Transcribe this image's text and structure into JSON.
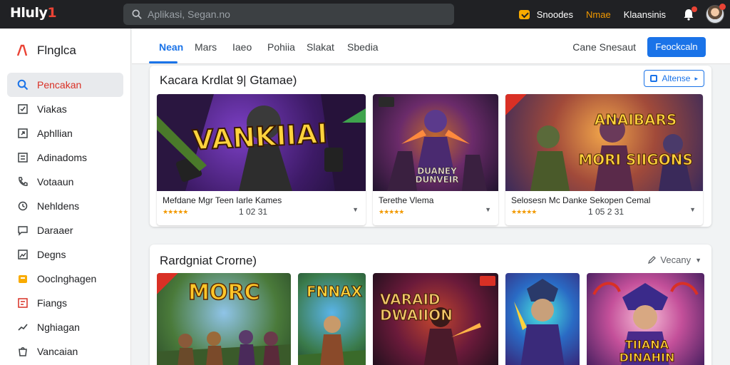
{
  "topbar": {
    "logo_main": "Hluly",
    "logo_accent": "1",
    "search_placeholder": "Aplikasi, Segan.no",
    "right_badge_label": "Snoodes",
    "link_orange": "Nmae",
    "link_white": "Klaansinis",
    "accent_color": "#ea4335"
  },
  "sidebar": {
    "brand": "Flnglca",
    "items": [
      {
        "label": "Pencakan",
        "icon": "search-icon",
        "active": true
      },
      {
        "label": "Viakas",
        "icon": "checkbox-icon"
      },
      {
        "label": "Aphllian",
        "icon": "expand-icon"
      },
      {
        "label": "Adinadoms",
        "icon": "grid-icon"
      },
      {
        "label": "Votaaun",
        "icon": "phone-icon"
      },
      {
        "label": "Nehldens",
        "icon": "history-icon"
      },
      {
        "label": "Daraaer",
        "icon": "chat-icon"
      },
      {
        "label": "Degns",
        "icon": "image-icon"
      },
      {
        "label": "Ooclnghagen",
        "icon": "box-icon"
      },
      {
        "label": "Fiangs",
        "icon": "tag-icon"
      },
      {
        "label": "Nghiagan",
        "icon": "trend-icon"
      },
      {
        "label": "Vancaian",
        "icon": "bag-icon"
      }
    ]
  },
  "main": {
    "tabs": [
      {
        "label": "Nean",
        "active": true
      },
      {
        "label": "Mars"
      },
      {
        "label": "Iaeo"
      },
      {
        "label": "Pohiia"
      },
      {
        "label": "Slakat"
      },
      {
        "label": "Sbedia"
      }
    ],
    "tabs_right_text": "Cane Snesaut",
    "primary_button": "Feockcaln",
    "section1": {
      "title": "Kacara Krdlat 9| Gtamae)",
      "button": "Altense",
      "cards": [
        {
          "art_title": "VANKIIAI",
          "label": "Mefdane  Mgr   Teen Iarle Kames",
          "count": "1 02 31",
          "stars": "★★★★★"
        },
        {
          "art_title": "DUANEY DUNVEIR",
          "label": "Terethe  Vlema",
          "count": "",
          "stars": "★★★★★"
        },
        {
          "art_title": "ANAIBARS  MORI SIIGONS",
          "label": "Selosesn  Mc Danke   Sekopen Cemal",
          "count": "1 05 2 31",
          "stars": "★★★★★"
        }
      ]
    },
    "section2": {
      "title": "Rardgniat  Crorne)",
      "link": "Vecany",
      "cards": [
        {
          "art_title": "MORC"
        },
        {
          "art_title": "FNNAX"
        },
        {
          "art_title": "VARAID DWAIION"
        },
        {
          "art_title": ""
        },
        {
          "art_title": "TIIANA DINAHIN"
        }
      ]
    }
  }
}
